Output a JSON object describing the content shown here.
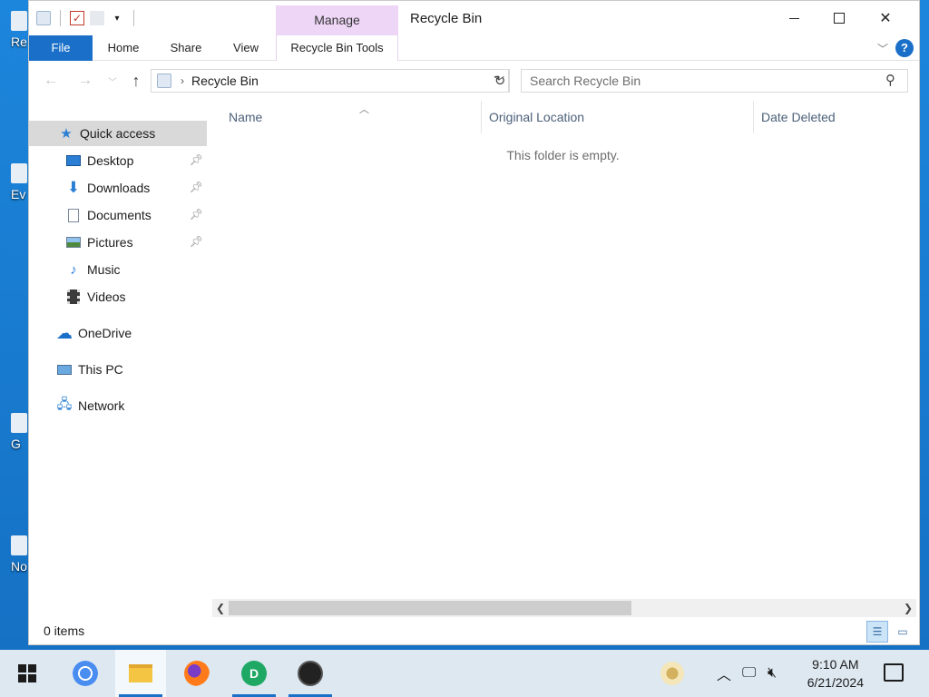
{
  "window": {
    "title": "Recycle Bin",
    "manage_tab": "Manage"
  },
  "ribbon": {
    "tabs": {
      "file": "File",
      "home": "Home",
      "share": "Share",
      "view": "View",
      "tools": "Recycle Bin Tools"
    },
    "help": "?"
  },
  "address": {
    "crumb": "Recycle Bin",
    "search_placeholder": "Search Recycle Bin"
  },
  "nav": {
    "quick_access": "Quick access",
    "items": [
      {
        "label": "Desktop",
        "icon": "desktop-icon",
        "pinned": true
      },
      {
        "label": "Downloads",
        "icon": "downloads-icon",
        "pinned": true
      },
      {
        "label": "Documents",
        "icon": "documents-icon",
        "pinned": true
      },
      {
        "label": "Pictures",
        "icon": "pictures-icon",
        "pinned": true
      },
      {
        "label": "Music",
        "icon": "music-icon",
        "pinned": false
      },
      {
        "label": "Videos",
        "icon": "videos-icon",
        "pinned": false
      }
    ],
    "onedrive": "OneDrive",
    "this_pc": "This PC",
    "network": "Network"
  },
  "columns": {
    "name": "Name",
    "original_location": "Original Location",
    "date_deleted": "Date Deleted"
  },
  "content": {
    "empty_message": "This folder is empty."
  },
  "status": {
    "items": "0 items"
  },
  "desktop": {
    "icon_labels": [
      "Re",
      "Ev",
      "G",
      "No"
    ]
  },
  "taskbar": {
    "time": "9:10 AM",
    "date": "6/21/2024",
    "apps": [
      "start-icon",
      "chrome-icon",
      "file-explorer-icon",
      "firefox-icon",
      "dashlane-icon",
      "obs-icon"
    ]
  },
  "colors": {
    "accent": "#1a6fc8",
    "manage_tab": "#eed6f7",
    "selected_nav": "#d9d9d9"
  },
  "scrollbar": {
    "thumb_fraction": 0.6
  }
}
